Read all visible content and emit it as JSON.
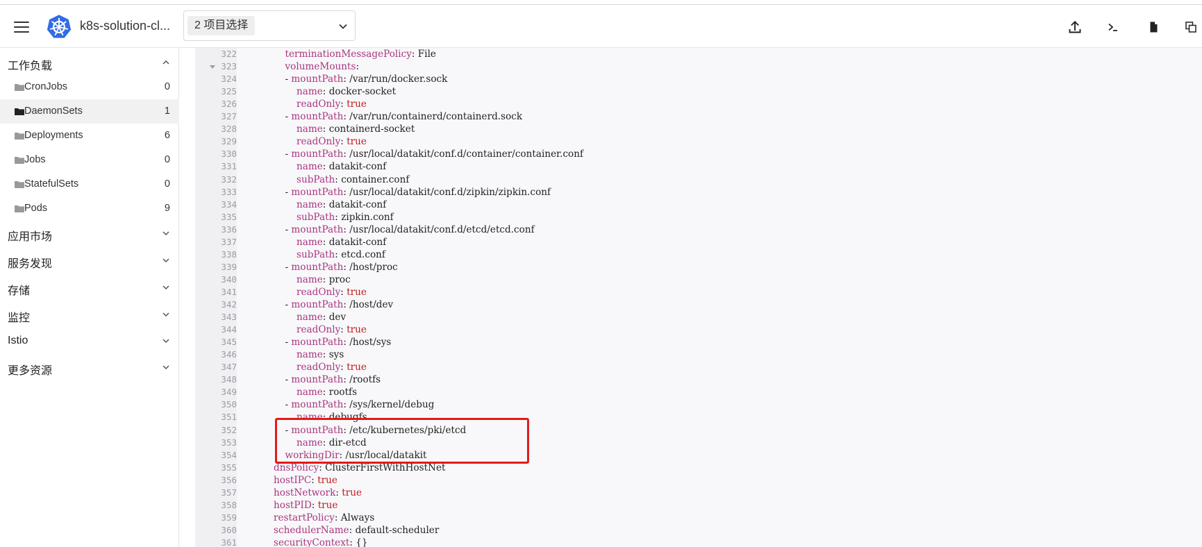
{
  "header": {
    "cluster_name": "k8s-solution-cl...",
    "namespace_select": "2 项目选择"
  },
  "icons": {
    "menu": "hamburger-icon",
    "logo": "kubernetes-logo",
    "chevron": "chevron-down-icon",
    "upload": "upload-icon",
    "terminal": "terminal-icon",
    "file": "file-icon",
    "copy": "copy-icon"
  },
  "sidebar": {
    "groups": [
      {
        "label": "工作负载",
        "expanded": true
      },
      {
        "label": "应用市场",
        "expanded": false
      },
      {
        "label": "服务发现",
        "expanded": false
      },
      {
        "label": "存储",
        "expanded": false
      },
      {
        "label": "监控",
        "expanded": false
      },
      {
        "label": "Istio",
        "expanded": false
      },
      {
        "label": "更多资源",
        "expanded": false
      }
    ],
    "workload_items": [
      {
        "label": "CronJobs",
        "count": "0",
        "active": false
      },
      {
        "label": "DaemonSets",
        "count": "1",
        "active": true
      },
      {
        "label": "Deployments",
        "count": "6",
        "active": false
      },
      {
        "label": "Jobs",
        "count": "0",
        "active": false
      },
      {
        "label": "StatefulSets",
        "count": "0",
        "active": false
      },
      {
        "label": "Pods",
        "count": "9",
        "active": false
      }
    ]
  },
  "editor": {
    "lines": [
      {
        "n": "322",
        "indent": 6,
        "key": "terminationMessagePolicy",
        "val": "File"
      },
      {
        "n": "323",
        "indent": 6,
        "key": "volumeMounts",
        "val": "",
        "fold": true
      },
      {
        "n": "324",
        "indent": 6,
        "dash": true,
        "key": "mountPath",
        "val": "/var/run/docker.sock"
      },
      {
        "n": "325",
        "indent": 8,
        "key": "name",
        "val": "docker-socket"
      },
      {
        "n": "326",
        "indent": 8,
        "key": "readOnly",
        "val": "true",
        "bool": true
      },
      {
        "n": "327",
        "indent": 6,
        "dash": true,
        "key": "mountPath",
        "val": "/var/run/containerd/containerd.sock"
      },
      {
        "n": "328",
        "indent": 8,
        "key": "name",
        "val": "containerd-socket"
      },
      {
        "n": "329",
        "indent": 8,
        "key": "readOnly",
        "val": "true",
        "bool": true
      },
      {
        "n": "330",
        "indent": 6,
        "dash": true,
        "key": "mountPath",
        "val": "/usr/local/datakit/conf.d/container/container.conf"
      },
      {
        "n": "331",
        "indent": 8,
        "key": "name",
        "val": "datakit-conf"
      },
      {
        "n": "332",
        "indent": 8,
        "key": "subPath",
        "val": "container.conf"
      },
      {
        "n": "333",
        "indent": 6,
        "dash": true,
        "key": "mountPath",
        "val": "/usr/local/datakit/conf.d/zipkin/zipkin.conf"
      },
      {
        "n": "334",
        "indent": 8,
        "key": "name",
        "val": "datakit-conf"
      },
      {
        "n": "335",
        "indent": 8,
        "key": "subPath",
        "val": "zipkin.conf"
      },
      {
        "n": "336",
        "indent": 6,
        "dash": true,
        "key": "mountPath",
        "val": "/usr/local/datakit/conf.d/etcd/etcd.conf"
      },
      {
        "n": "337",
        "indent": 8,
        "key": "name",
        "val": "datakit-conf"
      },
      {
        "n": "338",
        "indent": 8,
        "key": "subPath",
        "val": "etcd.conf"
      },
      {
        "n": "339",
        "indent": 6,
        "dash": true,
        "key": "mountPath",
        "val": "/host/proc"
      },
      {
        "n": "340",
        "indent": 8,
        "key": "name",
        "val": "proc"
      },
      {
        "n": "341",
        "indent": 8,
        "key": "readOnly",
        "val": "true",
        "bool": true
      },
      {
        "n": "342",
        "indent": 6,
        "dash": true,
        "key": "mountPath",
        "val": "/host/dev"
      },
      {
        "n": "343",
        "indent": 8,
        "key": "name",
        "val": "dev"
      },
      {
        "n": "344",
        "indent": 8,
        "key": "readOnly",
        "val": "true",
        "bool": true
      },
      {
        "n": "345",
        "indent": 6,
        "dash": true,
        "key": "mountPath",
        "val": "/host/sys"
      },
      {
        "n": "346",
        "indent": 8,
        "key": "name",
        "val": "sys"
      },
      {
        "n": "347",
        "indent": 8,
        "key": "readOnly",
        "val": "true",
        "bool": true
      },
      {
        "n": "348",
        "indent": 6,
        "dash": true,
        "key": "mountPath",
        "val": "/rootfs"
      },
      {
        "n": "349",
        "indent": 8,
        "key": "name",
        "val": "rootfs"
      },
      {
        "n": "350",
        "indent": 6,
        "dash": true,
        "key": "mountPath",
        "val": "/sys/kernel/debug"
      },
      {
        "n": "351",
        "indent": 8,
        "key": "name",
        "val": "debugfs"
      },
      {
        "n": "352",
        "indent": 6,
        "dash": true,
        "key": "mountPath",
        "val": "/etc/kubernetes/pki/etcd"
      },
      {
        "n": "353",
        "indent": 8,
        "key": "name",
        "val": "dir-etcd"
      },
      {
        "n": "354",
        "indent": 6,
        "key": "workingDir",
        "val": "/usr/local/datakit"
      },
      {
        "n": "355",
        "indent": 4,
        "key": "dnsPolicy",
        "val": "ClusterFirstWithHostNet"
      },
      {
        "n": "356",
        "indent": 4,
        "key": "hostIPC",
        "val": "true",
        "bool": true
      },
      {
        "n": "357",
        "indent": 4,
        "key": "hostNetwork",
        "val": "true",
        "bool": true
      },
      {
        "n": "358",
        "indent": 4,
        "key": "hostPID",
        "val": "true",
        "bool": true
      },
      {
        "n": "359",
        "indent": 4,
        "key": "restartPolicy",
        "val": "Always"
      },
      {
        "n": "360",
        "indent": 4,
        "key": "schedulerName",
        "val": "default-scheduler"
      },
      {
        "n": "361",
        "indent": 4,
        "key": "securityContext",
        "val": "{}"
      }
    ],
    "highlight_color": "#e21a1a"
  },
  "colors": {
    "yaml_key": "#a9357f",
    "yaml_bool": "#c01a1a",
    "k8s_logo": "#326ce5"
  }
}
